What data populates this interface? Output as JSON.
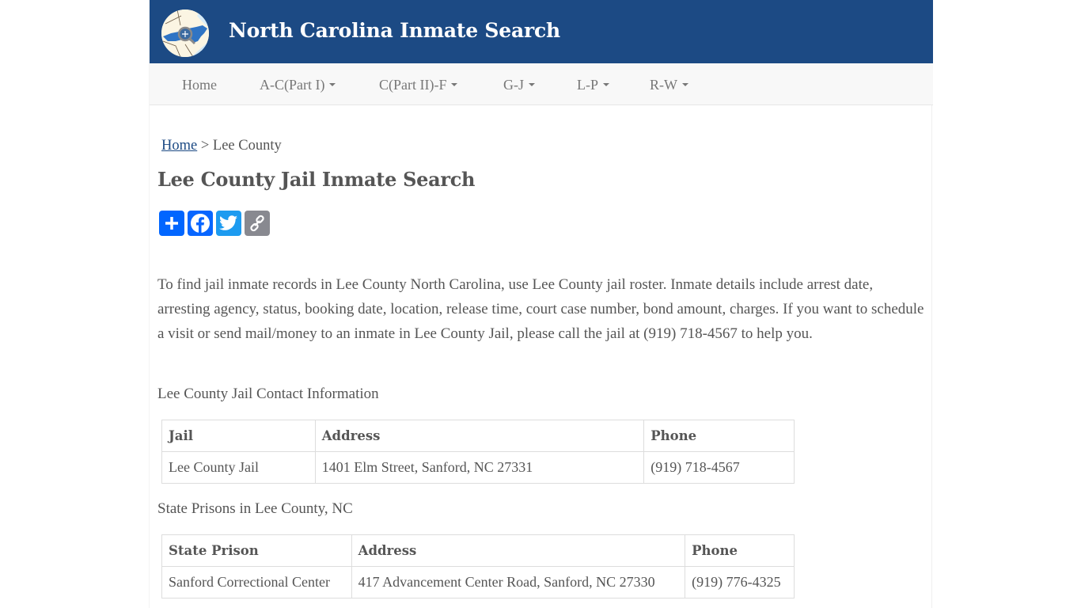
{
  "header": {
    "site_title": "North Carolina Inmate Search",
    "logo_icon": "nc-map-magnifier-logo"
  },
  "nav": {
    "items": [
      {
        "label": "Home",
        "dropdown": false
      },
      {
        "label": "A-C(Part I)",
        "dropdown": true
      },
      {
        "label": "C(Part II)-F",
        "dropdown": true
      },
      {
        "label": "G-J",
        "dropdown": true
      },
      {
        "label": "L-P",
        "dropdown": true
      },
      {
        "label": "R-W",
        "dropdown": true
      }
    ]
  },
  "breadcrumb": {
    "home_label": "Home",
    "separator": ">",
    "current": "Lee County"
  },
  "page_title": "Lee County Jail Inmate Search",
  "share": {
    "buttons": [
      {
        "name": "share",
        "icon": "plus-icon",
        "color": "#0166ff"
      },
      {
        "name": "facebook",
        "icon": "facebook-icon",
        "color": "#0866ff"
      },
      {
        "name": "twitter",
        "icon": "twitter-icon",
        "color": "#1d9bf0"
      },
      {
        "name": "copy-link",
        "icon": "link-icon",
        "color": "#888990"
      }
    ]
  },
  "intro": "To find jail inmate records in Lee County North Carolina, use Lee County jail roster. Inmate details include arrest date, arresting agency, status, booking date, location, release time, court case number, bond amount, charges. If you want to schedule a visit or send mail/money to an inmate in Lee County Jail, please call the jail at (919) 718-4567 to help you.",
  "jail_section": {
    "label": "Lee County Jail Contact Information",
    "headers": [
      "Jail",
      "Address",
      "Phone"
    ],
    "rows": [
      [
        "Lee County Jail",
        "1401 Elm Street, Sanford, NC 27331",
        "(919) 718-4567"
      ]
    ]
  },
  "prison_section": {
    "label": "State Prisons in Lee County, NC",
    "headers": [
      "State Prison",
      "Address",
      "Phone"
    ],
    "rows": [
      [
        "Sanford Correctional Center",
        "417 Advancement Center Road, Sanford, NC 27330",
        "(919) 776-4325"
      ]
    ]
  },
  "colors": {
    "header_bg": "#1c4a84",
    "navbar_bg": "#f8f8f8",
    "link": "#1c4a84",
    "text": "#555555"
  }
}
